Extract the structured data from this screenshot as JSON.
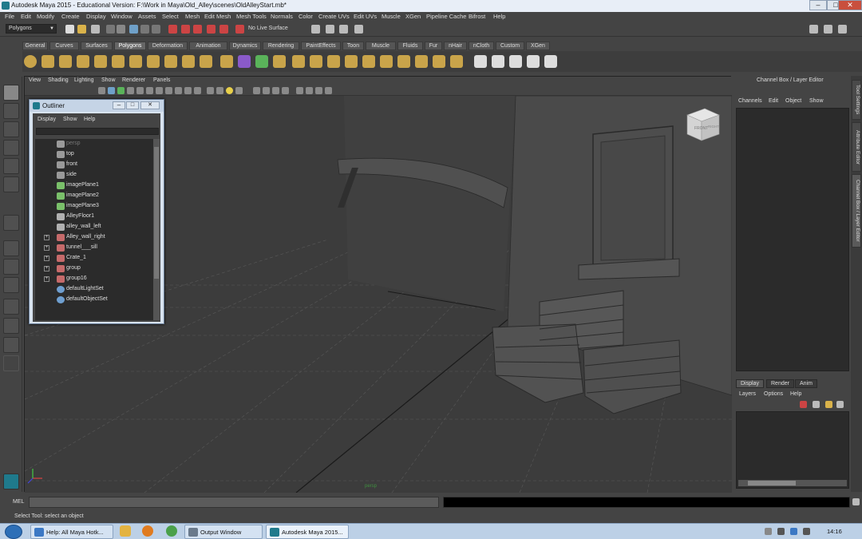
{
  "window": {
    "title": "Autodesk Maya 2015 - Educational Version: F:\\Work in Maya\\Old_Alley\\scenes\\OldAlleyStart.mb*",
    "minimize": "–",
    "maximize": "□",
    "close": "✕"
  },
  "menubar": [
    "File",
    "Edit",
    "Modify",
    "Create",
    "Display",
    "Window",
    "Assets",
    "Select",
    "Mesh",
    "Edit Mesh",
    "Mesh Tools",
    "Normals",
    "Color",
    "Create UVs",
    "Edit UVs",
    "Muscle",
    "XGen",
    "Pipeline Cache",
    "Bifrost",
    "Help"
  ],
  "statusline": {
    "mode": "Polygons",
    "live_surface": "No Live Surface"
  },
  "shelf_tabs": [
    "General",
    "Curves",
    "Surfaces",
    "Polygons",
    "Deformation",
    "Animation",
    "Dynamics",
    "Rendering",
    "PaintEffects",
    "Toon",
    "Muscle",
    "Fluids",
    "Fur",
    "nHair",
    "nCloth",
    "Custom",
    "XGen"
  ],
  "active_shelf_tab": "Polygons",
  "panel_menu": [
    "View",
    "Shading",
    "Lighting",
    "Show",
    "Renderer",
    "Panels"
  ],
  "viewport": {
    "view_cube_label": "FRONT",
    "view_cube_side": "RIGHT",
    "camera_label": "persp"
  },
  "outliner": {
    "title": "Outliner",
    "menu": [
      "Display",
      "Show",
      "Help"
    ],
    "items": [
      {
        "label": "persp",
        "icon": "camera-icon",
        "expandable": false,
        "dim": true
      },
      {
        "label": "top",
        "icon": "camera-icon",
        "expandable": false,
        "dim": false
      },
      {
        "label": "front",
        "icon": "camera-icon",
        "expandable": false,
        "dim": false
      },
      {
        "label": "side",
        "icon": "camera-icon",
        "expandable": false,
        "dim": false
      },
      {
        "label": "imagePlane1",
        "icon": "image-plane-icon",
        "expandable": false,
        "dim": false
      },
      {
        "label": "imagePlane2",
        "icon": "image-plane-icon",
        "expandable": false,
        "dim": false
      },
      {
        "label": "imagePlane3",
        "icon": "image-plane-icon",
        "expandable": false,
        "dim": false
      },
      {
        "label": "AlleyFloor1",
        "icon": "transform-icon",
        "expandable": false,
        "dim": false
      },
      {
        "label": "alley_wall_left",
        "icon": "transform-icon",
        "expandable": false,
        "dim": false
      },
      {
        "label": "Alley_wall_right",
        "icon": "mesh-icon",
        "expandable": true,
        "dim": false
      },
      {
        "label": "tunnel___sill",
        "icon": "mesh-icon",
        "expandable": true,
        "dim": false
      },
      {
        "label": "Crate_1",
        "icon": "mesh-icon",
        "expandable": true,
        "dim": false
      },
      {
        "label": "group",
        "icon": "mesh-icon",
        "expandable": true,
        "dim": false
      },
      {
        "label": "group16",
        "icon": "mesh-icon",
        "expandable": true,
        "dim": false
      },
      {
        "label": "defaultLightSet",
        "icon": "set-icon",
        "expandable": false,
        "dim": false
      },
      {
        "label": "defaultObjectSet",
        "icon": "set-icon",
        "expandable": false,
        "dim": false
      }
    ]
  },
  "channelbox": {
    "title": "Channel Box / Layer Editor",
    "menu": [
      "Channels",
      "Edit",
      "Object",
      "Show"
    ],
    "layer_tabs": [
      "Display",
      "Render",
      "Anim"
    ],
    "active_layer_tab": "Display",
    "layer_menu": [
      "Layers",
      "Options",
      "Help"
    ]
  },
  "vertical_tabs": [
    "Tool Settings",
    "Attribute Editor",
    "Channel Box / Layer Editor"
  ],
  "command_line": {
    "label": "MEL"
  },
  "help_line": "Select Tool: select an object",
  "taskbar": {
    "buttons": [
      {
        "label": "Help: All Maya Hotk...",
        "icon_color": "#3b78c4",
        "active": false
      },
      {
        "label": "Output Window",
        "icon_color": "#6a7a8c",
        "active": false
      },
      {
        "label": "Autodesk Maya 2015...",
        "icon_color": "#1f7a8c",
        "active": true
      }
    ],
    "clock": "14:16"
  },
  "colors": {
    "maya_ui": "#444444",
    "viewport_bg": "#3c3c3c",
    "taskbar": "#bcd0e6",
    "accent_teal": "#1f7a8c"
  }
}
